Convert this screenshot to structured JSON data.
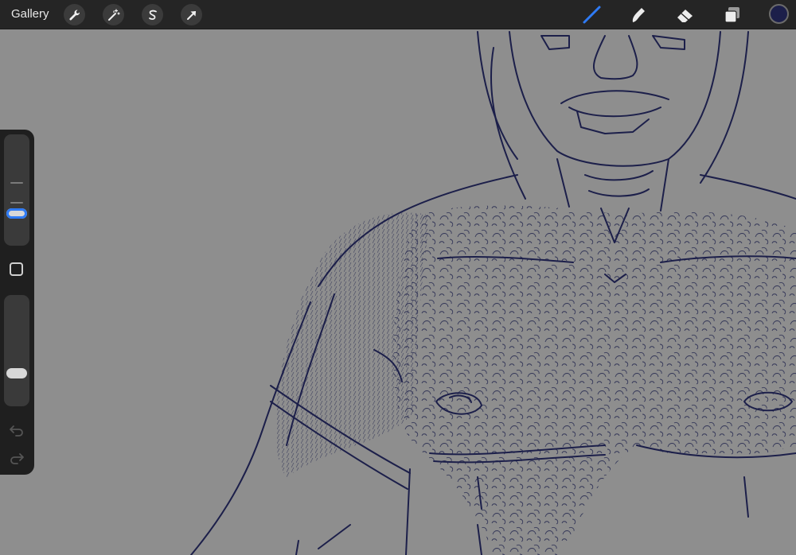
{
  "topbar": {
    "gallery_label": "Gallery",
    "left_tools": [
      {
        "name": "wrench-icon",
        "purpose": "actions"
      },
      {
        "name": "magic-wand-icon",
        "purpose": "adjustments"
      },
      {
        "name": "selection-s-icon",
        "purpose": "selection"
      },
      {
        "name": "arrow-cursor-icon",
        "purpose": "transform"
      }
    ],
    "right_tools": [
      {
        "name": "brush-icon",
        "active": true
      },
      {
        "name": "smudge-icon",
        "active": false
      },
      {
        "name": "eraser-icon",
        "active": false
      },
      {
        "name": "layers-icon",
        "active": false
      }
    ],
    "current_color": "#1c1f4a",
    "accent_color": "#2f7bf5"
  },
  "sidebar": {
    "brush_size_level": 0.82,
    "opacity_level": 0.28,
    "undo_enabled": false,
    "redo_enabled": false
  },
  "canvas": {
    "background": "#8e8e8e",
    "ink_color": "#1c1f4a"
  }
}
